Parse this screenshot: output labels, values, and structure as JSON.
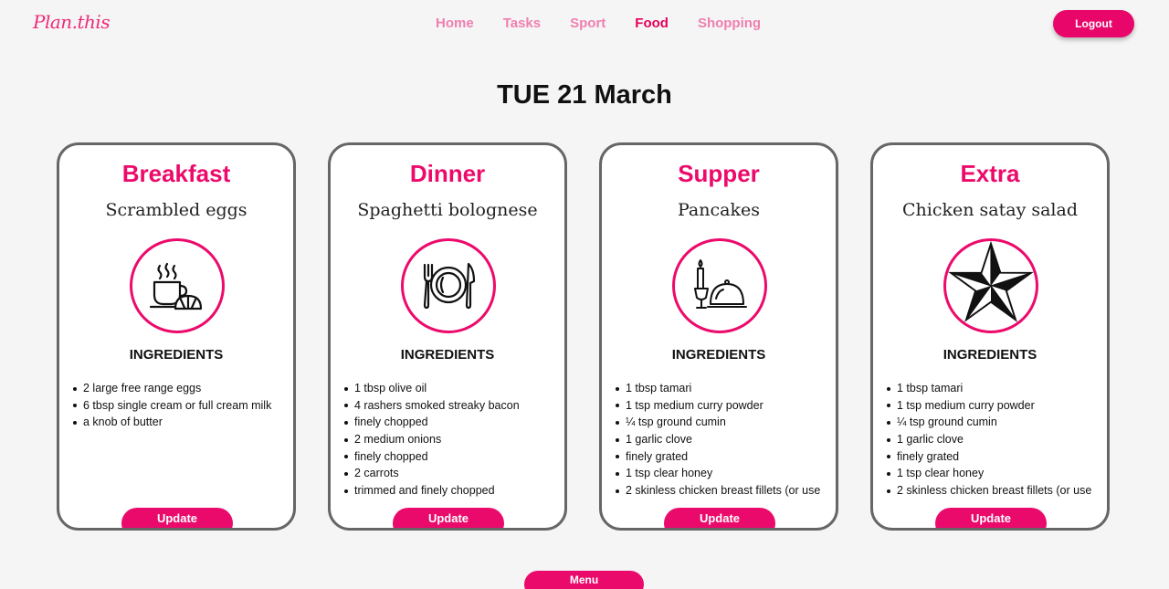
{
  "header": {
    "logo": "Plan.this",
    "nav": [
      {
        "label": "Home"
      },
      {
        "label": "Tasks"
      },
      {
        "label": "Sport"
      },
      {
        "label": "Food"
      },
      {
        "label": "Shopping"
      }
    ],
    "active_nav": "Food",
    "logout_label": "Logout"
  },
  "date_title": "TUE 21 March",
  "cards": [
    {
      "title": "Breakfast",
      "dish": "Scrambled eggs",
      "icon": "coffee-croissant-icon",
      "ingredients_title": "INGREDIENTS",
      "ingredients": [
        "2 large free range eggs",
        "6 tbsp single cream or full cream milk",
        "a knob of butter"
      ],
      "update_label": "Update"
    },
    {
      "title": "Dinner",
      "dish": "Spaghetti bolognese",
      "icon": "plate-cutlery-icon",
      "ingredients_title": "INGREDIENTS",
      "ingredients": [
        "1 tbsp olive oil",
        "4 rashers smoked streaky bacon",
        "finely chopped",
        "2 medium onions",
        "finely chopped",
        "2 carrots",
        "trimmed and finely chopped"
      ],
      "update_label": "Update"
    },
    {
      "title": "Supper",
      "dish": "Pancakes",
      "icon": "candle-cloche-icon",
      "ingredients_title": "INGREDIENTS",
      "ingredients": [
        "1 tbsp tamari",
        "1 tsp medium curry powder",
        "¼ tsp ground cumin",
        "1 garlic clove",
        "finely grated",
        "1 tsp clear honey",
        "2 skinless chicken breast fillets (or use"
      ],
      "update_label": "Update"
    },
    {
      "title": "Extra",
      "dish": "Chicken satay salad",
      "icon": "nautical-star-icon",
      "ingredients_title": "INGREDIENTS",
      "ingredients": [
        "1 tbsp tamari",
        "1 tsp medium curry powder",
        "¼ tsp ground cumin",
        "1 garlic clove",
        "finely grated",
        "1 tsp clear honey",
        "2 skinless chicken breast fillets (or use"
      ],
      "update_label": "Update"
    }
  ],
  "menu_label": "Menu",
  "colors": {
    "accent": "#ec0a6b",
    "nav_inactive": "#f07fb0",
    "background": "#f5f5f5",
    "card_border": "#666666"
  }
}
